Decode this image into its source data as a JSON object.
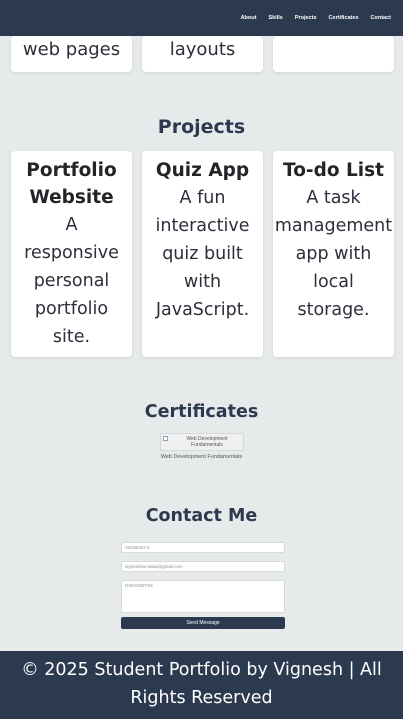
{
  "nav": {
    "links": [
      "About",
      "Skills",
      "Projects",
      "Certificates",
      "Contact"
    ]
  },
  "skills": {
    "partial_cards": [
      "web pages",
      "layouts",
      ""
    ]
  },
  "projects": {
    "title": "Projects",
    "items": [
      {
        "title_lines": [
          "Portfolio",
          "Website"
        ],
        "desc_lines": [
          "A",
          "responsive",
          "personal",
          "portfolio",
          "site."
        ]
      },
      {
        "title_lines": [
          "Quiz App"
        ],
        "desc_lines": [
          "A fun",
          "interactive",
          "quiz built",
          "with",
          "JavaScript."
        ]
      },
      {
        "title_lines": [
          "To-do List"
        ],
        "desc_lines": [
          "A task",
          "management",
          "app with",
          "local",
          "storage."
        ]
      }
    ]
  },
  "certificates": {
    "title": "Certificates",
    "image_alt": "Web Development Fundamentals",
    "caption": "Web Development Fundamentals"
  },
  "contact": {
    "title": "Contact Me",
    "name_value": "VIGNESH D",
    "email_value": "vigneshkurvalaa@gmail.com",
    "message_value": "DSKGGBTSS",
    "send_label": "Send Message"
  },
  "footer": {
    "line1": "© 2025 Student Portfolio by Vignesh | All",
    "line2": "Rights Reserved"
  }
}
